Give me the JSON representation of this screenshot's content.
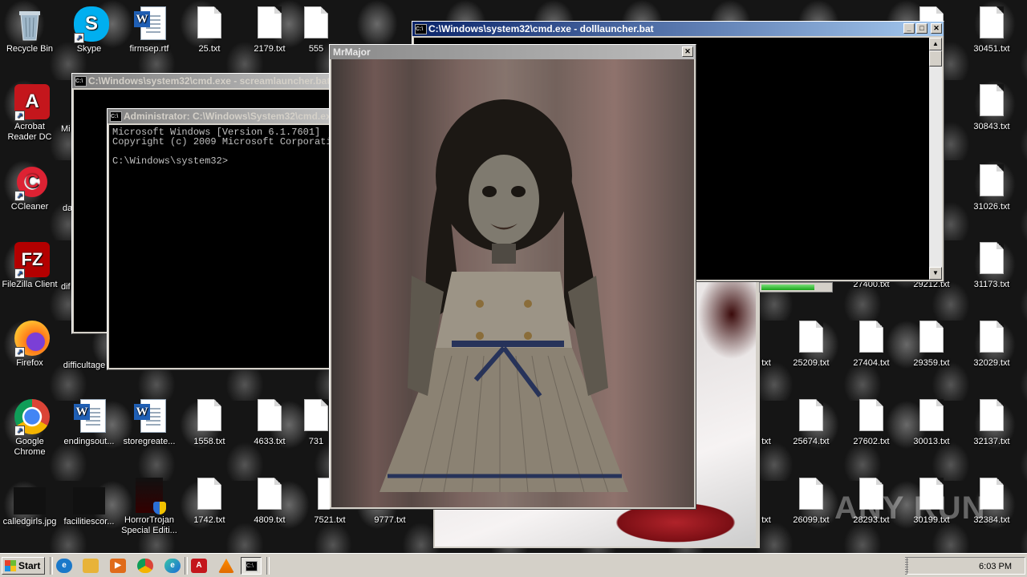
{
  "desktop": {
    "icons": [
      {
        "label": "Recycle Bin"
      },
      {
        "label": "Skype"
      },
      {
        "label": "firmsep.rtf"
      },
      {
        "label": "25.txt"
      },
      {
        "label": "2179.txt"
      },
      {
        "label": "555"
      },
      {
        "label": "30451.txt"
      },
      {
        "label": "Acrobat Reader DC"
      },
      {
        "label": "Mi"
      },
      {
        "label": "30843.txt"
      },
      {
        "label": "CCleaner"
      },
      {
        "label": "da"
      },
      {
        "label": "31026.txt"
      },
      {
        "label": "FileZilla Client"
      },
      {
        "label": "dif"
      },
      {
        "label": "27400.txt"
      },
      {
        "label": "29212.txt"
      },
      {
        "label": "31173.txt"
      },
      {
        "label": "Firefox"
      },
      {
        "label": "difficultage"
      },
      {
        "label": "txt"
      },
      {
        "label": "25209.txt"
      },
      {
        "label": "27404.txt"
      },
      {
        "label": "29359.txt"
      },
      {
        "label": "32029.txt"
      },
      {
        "label": "Google Chrome"
      },
      {
        "label": "endingsout..."
      },
      {
        "label": "storegreate..."
      },
      {
        "label": "1558.txt"
      },
      {
        "label": "4633.txt"
      },
      {
        "label": "731"
      },
      {
        "label": "txt"
      },
      {
        "label": "25674.txt"
      },
      {
        "label": "27602.txt"
      },
      {
        "label": "30013.txt"
      },
      {
        "label": "32137.txt"
      },
      {
        "label": "calledgirls.jpg"
      },
      {
        "label": "facilitiescor..."
      },
      {
        "label": "HorrorTrojan Special Editi..."
      },
      {
        "label": "1742.txt"
      },
      {
        "label": "4809.txt"
      },
      {
        "label": "7521.txt"
      },
      {
        "label": "9777.txt"
      },
      {
        "label": "txt"
      },
      {
        "label": "26099.txt"
      },
      {
        "label": "28293.txt"
      },
      {
        "label": "30199.txt"
      },
      {
        "label": "32384.txt"
      },
      {
        "label": "txt"
      },
      {
        "label": "txt"
      }
    ]
  },
  "windows": {
    "doll_cmd": {
      "title": "C:\\Windows\\system32\\cmd.exe - dolllauncher.bat"
    },
    "scream_cmd": {
      "title": "C:\\Windows\\system32\\cmd.exe - screamlauncher.bat"
    },
    "admin_cmd": {
      "title": "Administrator: C:\\Windows\\System32\\cmd.exe",
      "lines": [
        "Microsoft Windows [Version 6.1.7601]",
        "Copyright (c) 2009 Microsoft Corporation.  All rights reserved.",
        "",
        "C:\\Windows\\system32>"
      ]
    },
    "mrmajor": {
      "title": "MrMajor"
    }
  },
  "taskbar": {
    "start_label": "Start",
    "clock": "6:03 PM"
  },
  "watermark": {
    "text": "ANY RUN"
  }
}
